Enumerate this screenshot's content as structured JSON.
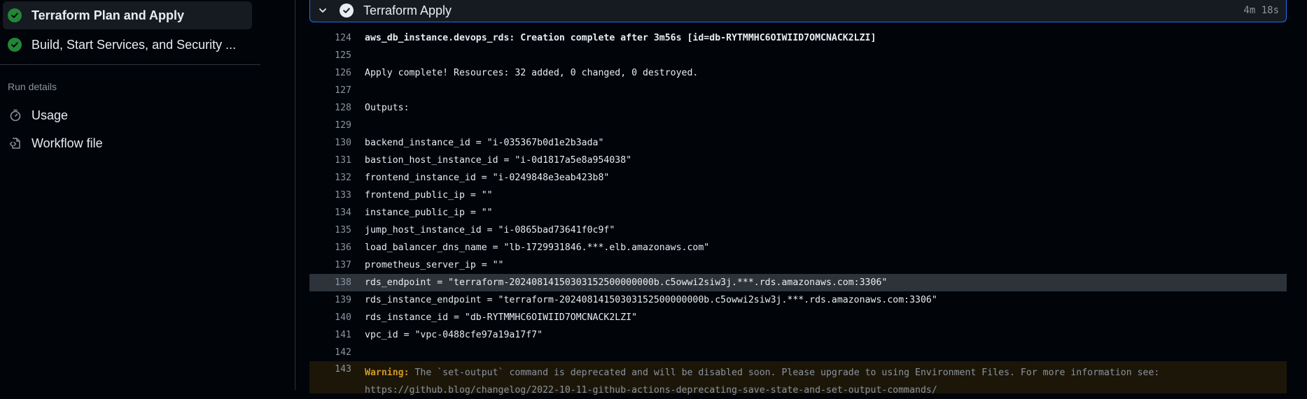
{
  "sidebar": {
    "jobs": [
      {
        "label": "Terraform Plan and Apply",
        "status": "success"
      },
      {
        "label": "Build, Start Services, and Security ...",
        "status": "success"
      }
    ],
    "run_details_title": "Run details",
    "nav": [
      {
        "label": "Usage",
        "icon": "stopwatch-icon"
      },
      {
        "label": "Workflow file",
        "icon": "file-code-icon"
      }
    ]
  },
  "step": {
    "title": "Terraform Apply",
    "duration": "4m 18s"
  },
  "log_lines": [
    {
      "num": "124",
      "text": "aws_db_instance.devops_rds: Creation complete after 3m56s [id=db-RYTMMHC6OIWIID7OMCNACK2LZI]"
    },
    {
      "num": "125",
      "text": ""
    },
    {
      "num": "126",
      "text": "Apply complete! Resources: 32 added, 0 changed, 0 destroyed."
    },
    {
      "num": "127",
      "text": ""
    },
    {
      "num": "128",
      "text": "Outputs:"
    },
    {
      "num": "129",
      "text": ""
    },
    {
      "num": "130",
      "text": "backend_instance_id = \"i-035367b0d1e2b3ada\""
    },
    {
      "num": "131",
      "text": "bastion_host_instance_id = \"i-0d1817a5e8a954038\""
    },
    {
      "num": "132",
      "text": "frontend_instance_id = \"i-0249848e3eab423b8\""
    },
    {
      "num": "133",
      "text": "frontend_public_ip = \"\""
    },
    {
      "num": "134",
      "text": "instance_public_ip = \"\""
    },
    {
      "num": "135",
      "text": "jump_host_instance_id = \"i-0865bad73641f0c9f\""
    },
    {
      "num": "136",
      "text": "load_balancer_dns_name = \"lb-1729931846.***.elb.amazonaws.com\""
    },
    {
      "num": "137",
      "text": "prometheus_server_ip = \"\""
    },
    {
      "num": "138",
      "text": "rds_endpoint = \"terraform-20240814150303152500000000b.c5owwi2siw3j.***.rds.amazonaws.com:3306\""
    },
    {
      "num": "139",
      "text": "rds_instance_endpoint = \"terraform-20240814150303152500000000b.c5owwi2siw3j.***.rds.amazonaws.com:3306\""
    },
    {
      "num": "140",
      "text": "rds_instance_id = \"db-RYTMMHC6OIWIID7OMCNACK2LZI\""
    },
    {
      "num": "141",
      "text": "vpc_id = \"vpc-0488cfe97a19a17f7\""
    },
    {
      "num": "142",
      "text": ""
    }
  ],
  "warning_line": {
    "num": "143",
    "label": "Warning:",
    "text": " The `set-output` command is deprecated and will be disabled soon. Please upgrade to using Environment Files. For more information see:\nhttps://github.blog/changelog/2022-10-11-github-actions-deprecating-save-state-and-set-output-commands/"
  }
}
